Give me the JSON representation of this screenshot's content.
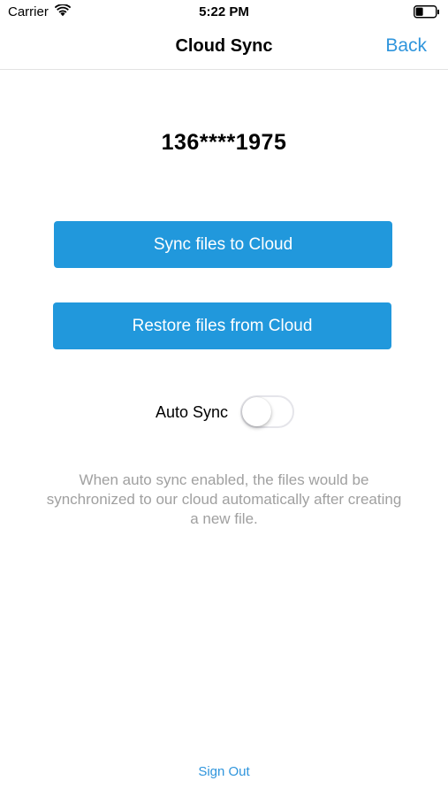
{
  "status_bar": {
    "carrier": "Carrier",
    "time": "5:22 PM",
    "wifi_icon": "wifi-icon",
    "battery_icon": "battery-icon"
  },
  "nav": {
    "title": "Cloud Sync",
    "back_label": "Back"
  },
  "account": {
    "masked_phone": "136****1975"
  },
  "actions": {
    "sync_label": "Sync files to Cloud",
    "restore_label": "Restore files from Cloud"
  },
  "auto_sync": {
    "label": "Auto Sync",
    "enabled": false
  },
  "description": "When auto sync enabled, the files would be synchronized to our cloud automatically after creating a new file.",
  "footer": {
    "signout_label": "Sign Out"
  },
  "colors": {
    "accent": "#2198dc",
    "link": "#2f95dc",
    "muted_text": "#a0a0a0"
  }
}
